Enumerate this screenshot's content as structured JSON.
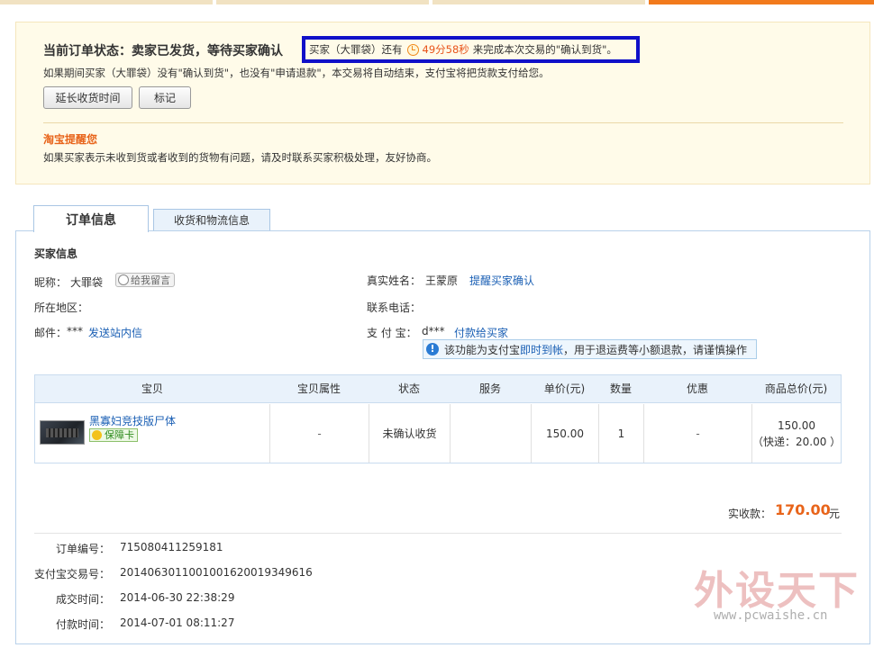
{
  "status": {
    "title": "当前订单状态：卖家已发货，等待买家确认",
    "countdown": {
      "prefix": "买家（大罪袋）还有",
      "time": "49分58秒",
      "suffix": "来完成本次交易的\"确认到货\"。"
    },
    "desc": "如果期间买家（大罪袋）没有\"确认到货\"，也没有\"申请退款\"，本交易将自动结束，支付宝将把货款支付给您。",
    "buttons": {
      "extend": "延长收货时间",
      "mark": "标记"
    },
    "remind_title": "淘宝提醒您",
    "remind_text": "如果买家表示未收到货或者收到的货物有问题，请及时联系买家积极处理，友好协商。"
  },
  "tabs": [
    {
      "label": "订单信息"
    },
    {
      "label": "收货和物流信息"
    }
  ],
  "buyer": {
    "heading": "买家信息",
    "nickname_label": "昵称：",
    "nickname": "大罪袋",
    "msg_button": "给我留言",
    "realname_label": "真实姓名：",
    "realname": "王蒙原",
    "remind_link": "提醒买家确认",
    "region_label": "所在地区：",
    "phone_label": "联系电话：",
    "email_label": "邮件：",
    "email": "***",
    "station_link": "发送站内信",
    "alipay_label": "支 付 宝：",
    "alipay": "d***",
    "pay_link": "付款给买家",
    "tip": {
      "before": "该功能为支付宝",
      "link": "即时到帐",
      "after": "，用于退运费等小额退款，请谨慎操作"
    }
  },
  "table": {
    "headers": [
      "宝贝",
      "宝贝属性",
      "状态",
      "服务",
      "单价(元)",
      "数量",
      "优惠",
      "商品总价(元)"
    ],
    "row": {
      "name": "黑寡妇竞技版尸体",
      "guarantee": "保障卡",
      "attr": "-",
      "status": "未确认收货",
      "service": "",
      "price": "150.00",
      "qty": "1",
      "discount": "-",
      "total": "150.00",
      "shipping": "（快递：20.00 ）"
    }
  },
  "paid": {
    "label": "实收款：",
    "amount": "170.00",
    "unit": "元"
  },
  "order": {
    "no_label": "订单编号：",
    "no": "715080411259181",
    "alipay_no_label": "支付宝交易号：",
    "alipay_no": "2014063011001001620019349616",
    "deal_time_label": "成交时间：",
    "deal_time": "2014-06-30 22:38:29",
    "pay_time_label": "付款时间：",
    "pay_time": "2014-07-01 08:11:27"
  },
  "watermark": {
    "cn": "外设天下",
    "en": "www.pcwaishe.cn"
  },
  "colors": {
    "accent": "#e8641a",
    "link": "#1a5fb4",
    "highlight_border": "#1010c8"
  }
}
